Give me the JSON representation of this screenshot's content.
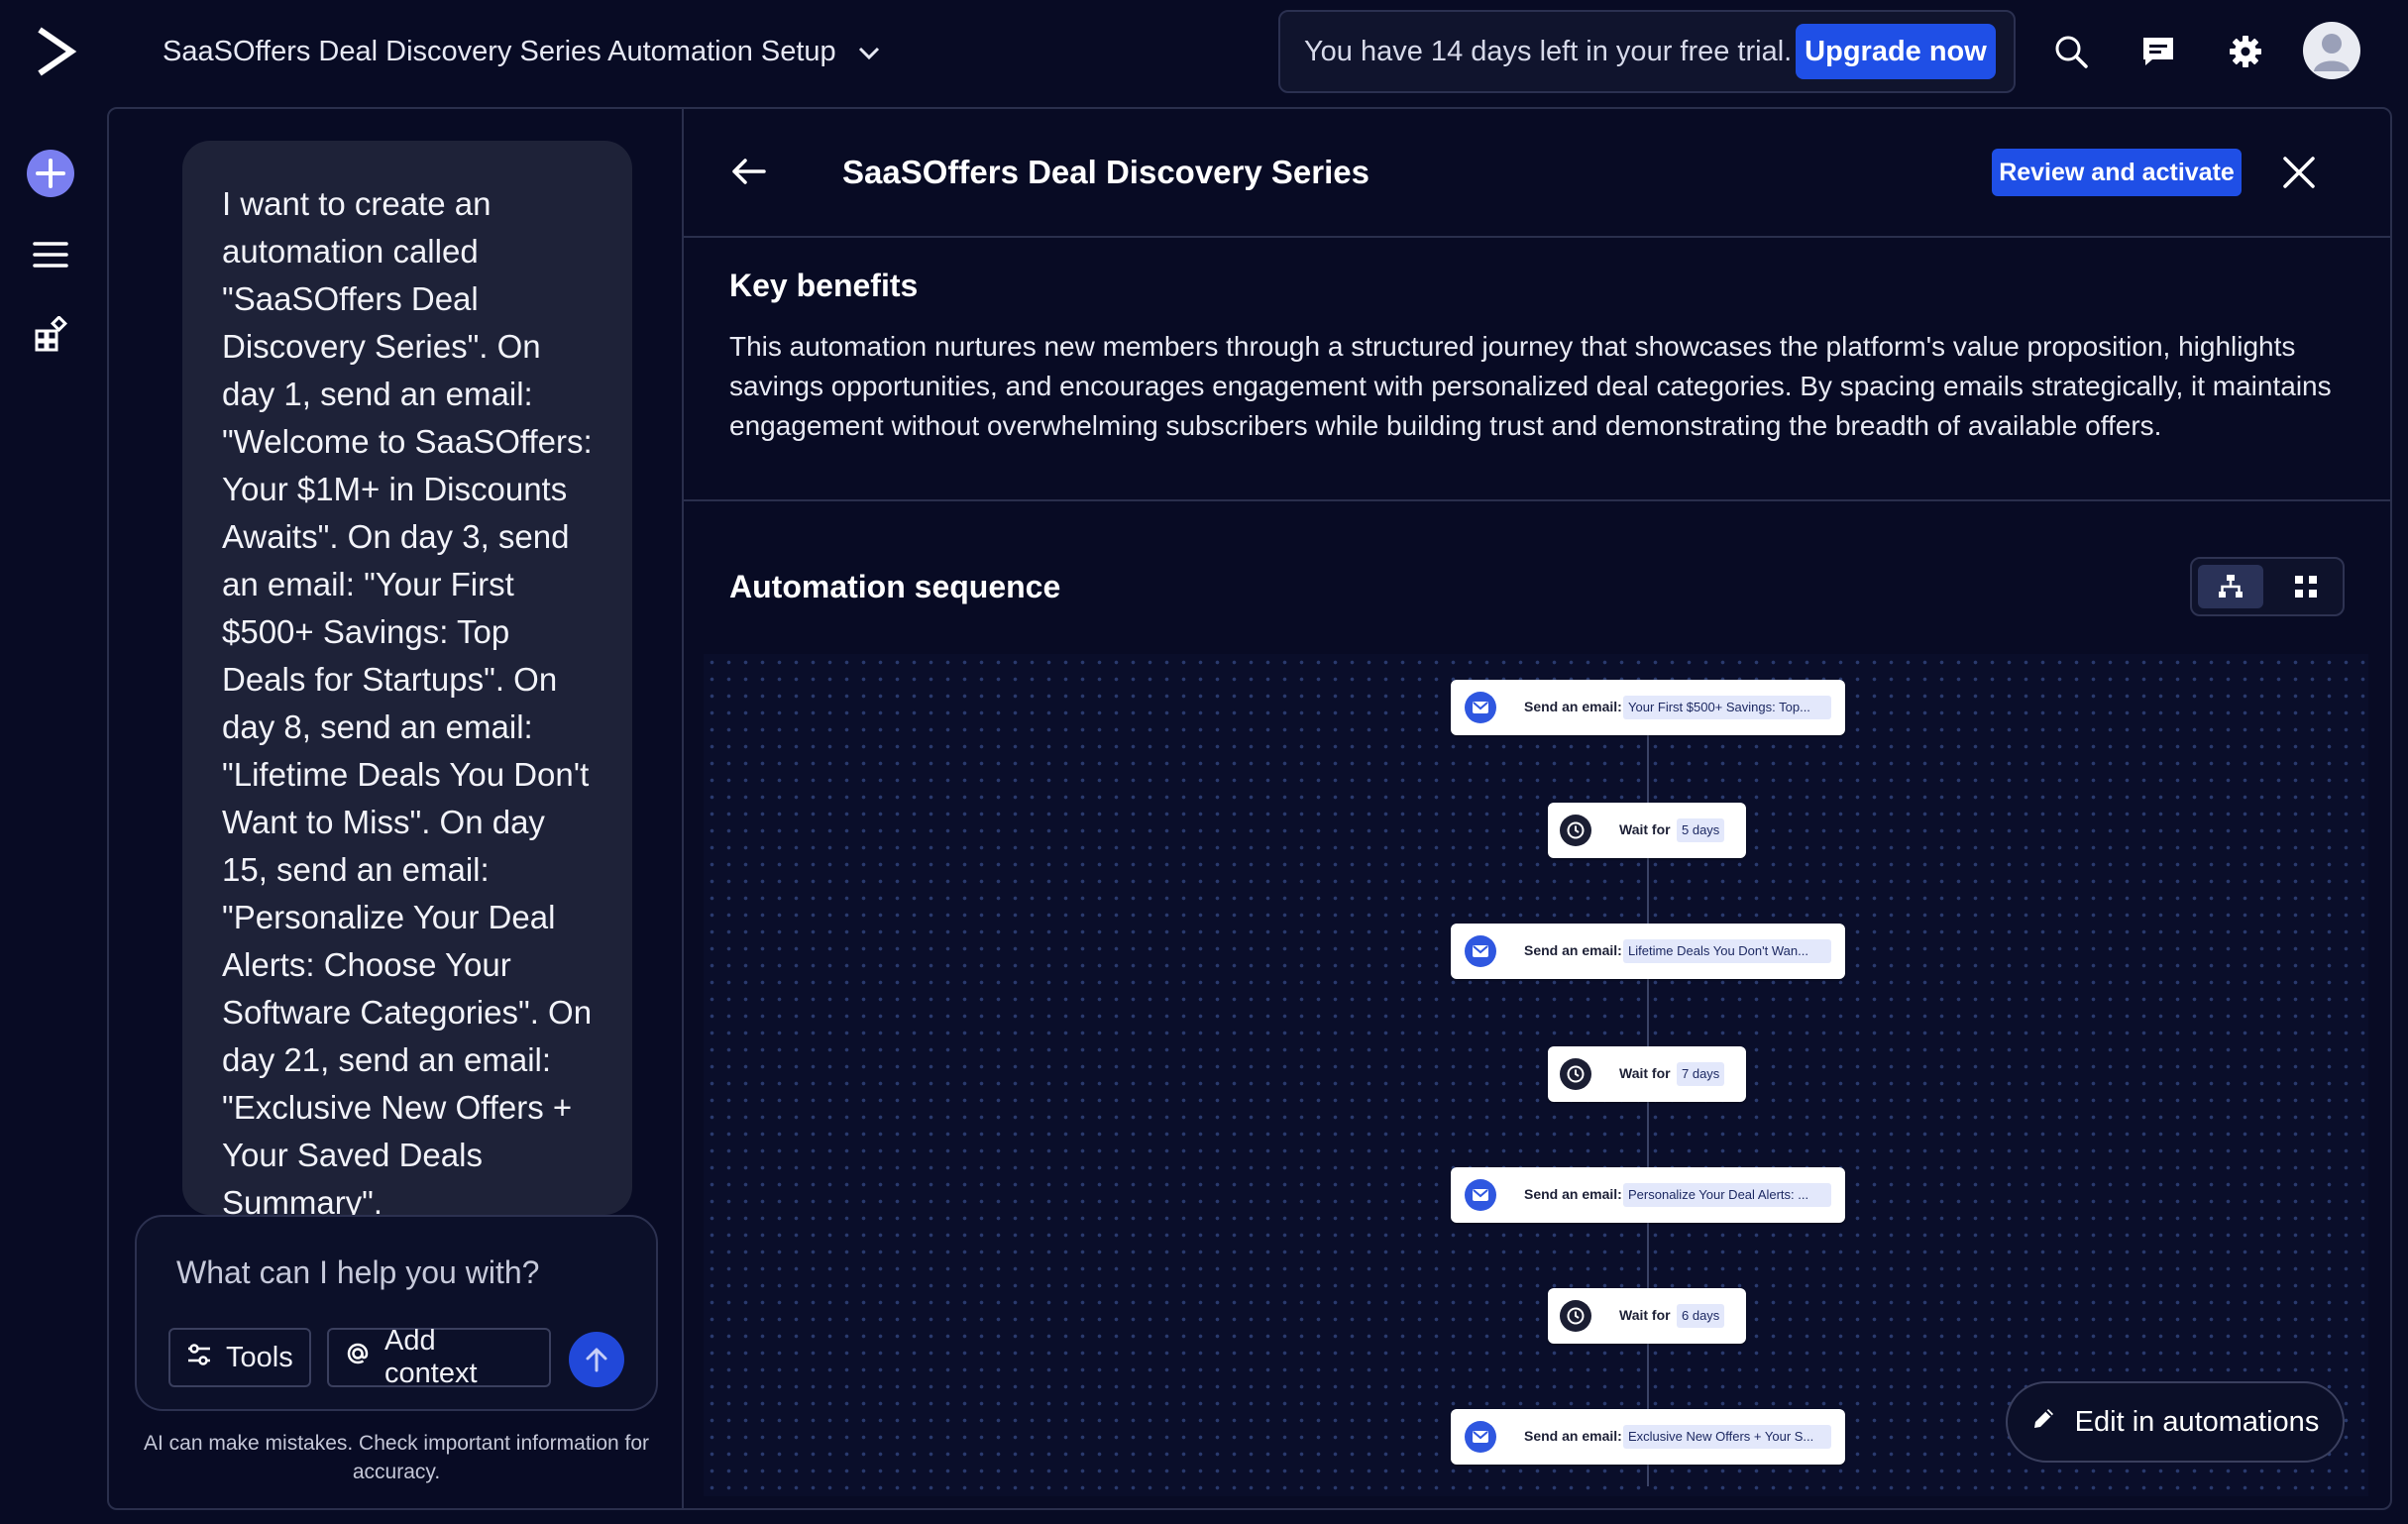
{
  "header": {
    "project_title": "SaaSOffers Deal Discovery Series Automation Setup",
    "trial_text": "You have 14 days left in your free trial.",
    "upgrade_label": "Upgrade now"
  },
  "icons": {
    "logo": "activecampaign-chevron-logo",
    "search": "search-icon",
    "chat": "message-icon",
    "settings": "gear-icon",
    "avatar": "user-avatar-icon",
    "rail": [
      "plus-circle-icon",
      "menu-icon",
      "apps-icon"
    ]
  },
  "chat": {
    "user_message": "I want to create an automation called \"SaaSOffers Deal Discovery Series\". On day 1, send an email: \"Welcome to SaaSOffers: Your $1M+ in Discounts Awaits\". On day 3, send an email: \"Your First $500+ Savings: Top Deals for Startups\". On day 8, send an email: \"Lifetime Deals You Don't Want to Miss\". On day 15, send an email: \"Personalize Your Deal Alerts: Choose Your Software Categories\". On day 21, send an email: \"Exclusive New Offers + Your Saved Deals Summary\".",
    "input_placeholder": "What can I help you with?",
    "tools_label": "Tools",
    "add_context_label": "Add context",
    "disclaimer": "AI can make mistakes. Check important information for accuracy."
  },
  "panel": {
    "title": "SaaSOffers Deal Discovery Series",
    "review_label": "Review and activate",
    "benefits_heading": "Key benefits",
    "benefits_text": "This automation nurtures new members through a structured journey that showcases the platform's value proposition, highlights savings opportunities, and encourages engagement with personalized deal categories. By spacing emails strategically, it maintains engagement without overwhelming subscribers while building trust and demonstrating the breadth of available offers.",
    "sequence_heading": "Automation sequence",
    "edit_label": "Edit in automations"
  },
  "sequence": [
    {
      "type": "email",
      "label": "Send an email:",
      "value": "Your First $500+ Savings: Top..."
    },
    {
      "type": "wait",
      "label": "Wait for",
      "value": "5 days"
    },
    {
      "type": "email",
      "label": "Send an email:",
      "value": "Lifetime Deals You Don't Wan..."
    },
    {
      "type": "wait",
      "label": "Wait for",
      "value": "7 days"
    },
    {
      "type": "email",
      "label": "Send an email:",
      "value": "Personalize Your Deal Alerts: ..."
    },
    {
      "type": "wait",
      "label": "Wait for",
      "value": "6 days"
    },
    {
      "type": "email",
      "label": "Send an email:",
      "value": "Exclusive New Offers + Your S..."
    }
  ],
  "colors": {
    "background": "#080b24",
    "accent": "#1f4fe6",
    "panel_border": "#2a2f4c"
  }
}
